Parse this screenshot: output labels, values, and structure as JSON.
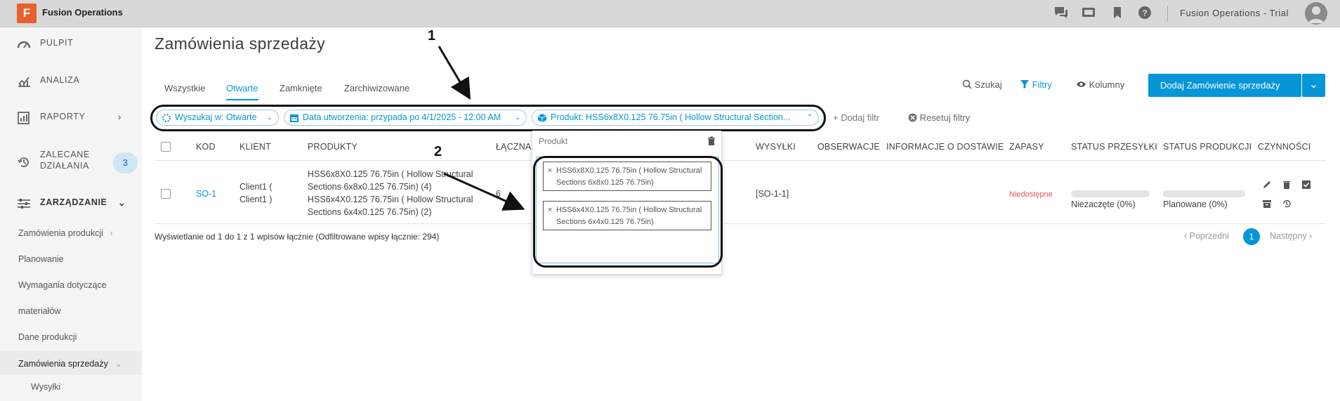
{
  "app": {
    "name": "Fusion Operations",
    "logo_letter": "F",
    "trial": "Fusion Operations - Trial"
  },
  "sidebar": {
    "nav": [
      {
        "label": "PULPIT",
        "icon": "dashboard-icon"
      },
      {
        "label": "ANALIZA",
        "icon": "chart-icon"
      },
      {
        "label": "RAPORTY",
        "icon": "report-icon"
      },
      {
        "label": "ZALECANE DZIAŁANIA",
        "badge": "3",
        "icon": "history-icon"
      },
      {
        "label": "ZARZĄDZANIE",
        "icon": "sliders-icon"
      }
    ],
    "nav_line2": "DZIAŁANIA",
    "nav_line1": "ZALECANE",
    "sub": [
      "Zamówienia produkcji",
      "Planowanie",
      "Wymagania dotyczące",
      "materiałów",
      "Dane produkcji",
      "Zamówienia sprzedaży",
      "Wysyłki"
    ]
  },
  "page": {
    "title": "Zamówienia sprzedaży"
  },
  "tabs": [
    "Wszystkie",
    "Otwarte",
    "Zamknięte",
    "Zarchiwizowane"
  ],
  "toolbar": {
    "search": "Szukaj",
    "filters": "Filtry",
    "columns": "Kolumny",
    "add": "Dodaj Zamówienie sprzedaży"
  },
  "filters": {
    "search_in": "Wyszukaj w: Otwarte",
    "date": "Data utworzenia: przypada po 4/1/2025 - 12:00 AM",
    "product": "Produkt: HSS6x8X0.125 76.75in ( Hollow Structural Section...",
    "add": "+ Dodaj filtr",
    "reset": "Resetuj filtry"
  },
  "table": {
    "headers": [
      "KOD",
      "KLIENT",
      "PRODUKTY",
      "ŁĄCZNA",
      "WYSYŁKI",
      "OBSERWACJE",
      "INFORMACJE O DOSTAWIE",
      "ZAPASY",
      "STATUS PRZESYŁKI",
      "STATUS PRODUKCJI",
      "CZYNNOŚCI"
    ],
    "row": {
      "code": "SO-1",
      "client_line1": "Client1 (",
      "client_line2": "Client1 )",
      "products": [
        "HSS6x8X0.125 76.75in ( Hollow Structural",
        "Sections 6x8x0.125 76.75in) (4)",
        "HSS6x4X0.125 76.75in ( Hollow Structural",
        "Sections 6x4x0.125 76.75in) (2)"
      ],
      "total": "6",
      "shipments": "[SO-1-1]",
      "stock": "Niedostępne",
      "shipment_status": "Niezaczęte (0%)",
      "production_status": "Planowane (0%)"
    }
  },
  "summary": "Wyświetlanie od 1 do 1 z 1 wpisów łącznie (Odfiltrowane wpisy łącznie: 294)",
  "pager": {
    "prev": "‹ Poprzedni",
    "page": "1",
    "next": "Następny ›"
  },
  "popup": {
    "label": "Produkt",
    "chips": [
      {
        "line1": "HSS6x8X0.125 76.75in ( Hollow Structural",
        "line2": "Sections 6x8x0.125 76.75in)"
      },
      {
        "line1": "HSS6x4X0.125 76.75in ( Hollow Structural",
        "line2": "Sections 6x4x0.125 76.75in)"
      }
    ]
  },
  "callouts": [
    "1",
    "2"
  ],
  "colors": {
    "accent": "#0696d7",
    "brand": "#e8602c",
    "topbar": "#d8d8d8",
    "sidebar": "#f5f5f5"
  }
}
